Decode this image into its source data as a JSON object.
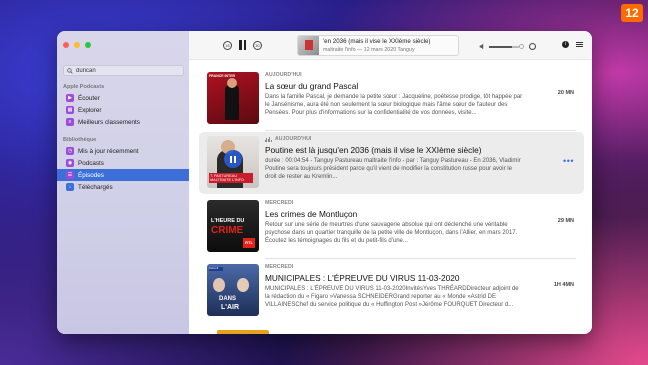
{
  "badge": "12",
  "sidebar": {
    "search_value": "duncan",
    "sections": [
      {
        "title": "Apple Podcasts",
        "items": [
          {
            "label": "Écouter",
            "icon": "play-circle-icon",
            "color": "#9b4dd6"
          },
          {
            "label": "Explorer",
            "icon": "grid-icon",
            "color": "#9b4dd6"
          },
          {
            "label": "Meilleurs classements",
            "icon": "list-icon",
            "color": "#9b4dd6"
          }
        ]
      },
      {
        "title": "Bibliothèque",
        "items": [
          {
            "label": "Mis à jour récemment",
            "icon": "clock-icon",
            "color": "#9b4dd6"
          },
          {
            "label": "Podcasts",
            "icon": "podcast-icon",
            "color": "#9b4dd6"
          },
          {
            "label": "Épisodes",
            "icon": "episodes-icon",
            "color": "#9b4dd6",
            "active": true
          },
          {
            "label": "Téléchargés",
            "icon": "download-icon",
            "color": "#3c6fd8"
          }
        ]
      }
    ]
  },
  "toolbar": {
    "skip_back": "15",
    "skip_forward": "30",
    "now_playing_title": "'en 2036 (mais il vise le XXIème siècle)",
    "now_playing_sub": "maltraite l'info — 12 mars 2020    Tanguy",
    "volume_level": 0.75,
    "info_glyph": "i"
  },
  "episodes": [
    {
      "date": "AUJOURD'HUI",
      "title": "La sœur du grand Pascal",
      "desc": "Dans la famille Pascal, je demande la petite sœur : Jacqueline, poétesse prodige, tôt happée par le Jansénisme, aura été non seulement la sœur biologique mais l'âme sœur de l'auteur des Pensées.  Pour plus d'informations sur la confidentialité de vos données, visite...",
      "duration": "20 MN",
      "art_caption": "FRANCE INTER"
    },
    {
      "date": "AUJOURD'HUI",
      "title": "Poutine est là jusqu'en 2036 (mais il vise le XXIème siècle)",
      "desc": "durée : 00:04:54 - Tanguy Pastureau maltraite l'info - par : Tanguy Pastureau - En 2036, Vladimir Poutine sera toujours président parce qu'il vient de modifier la constitution russe pour avoir le droit de rester au Kremlin...",
      "more": "•••",
      "art_caption": "T. PASTUREAU MALTRAITE L'INFO"
    },
    {
      "date": "MERCREDI",
      "title": "Les crimes de Montluçon",
      "desc": "Retour sur une série de meurtres d'une sauvagerie absolue qui ont déclenché une véritable psychose dans un quartier tranquille de la petite ville de Montluçon, dans l'Allier, en mars 2017. Écoutez les témoignages du fils et du petit-fils d'une...",
      "duration": "29 MN",
      "art_line1": "L'HEURE DU",
      "art_line2": "CRIME",
      "art_logo": "RTL"
    },
    {
      "date": "MERCREDI",
      "title": "MUNICIPALES : L'ÉPREUVE DU VIRUS  11-03-2020",
      "desc": "MUNICIPALES : L'ÉPREUVE DU VIRUS  11-03-2020InvitésYves THRÉARDDirecteur adjoint de la rédaction du « Figaro »Vanessa SCHNEIDERGrand reporter au « Monde »Astrid DE VILLAINESChef du service politique du « Huffington Post »Jérôme FOURQUET Directeur d...",
      "duration": "1H 4MN",
      "art_line1": "DANS",
      "art_line2": "L'AIR",
      "art_logo": "france•5"
    }
  ]
}
